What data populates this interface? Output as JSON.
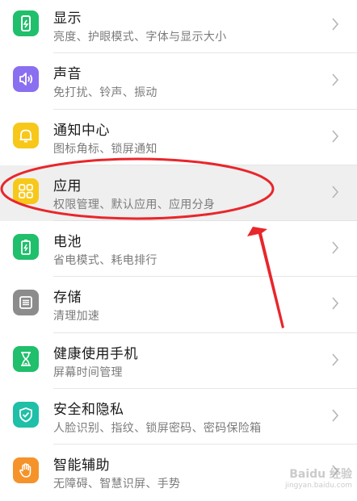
{
  "items": [
    {
      "title": "显示",
      "subtitle": "亮度、护眼模式、字体与显示大小",
      "icon": "display-icon",
      "color": "#1fbf6b",
      "highlight": false
    },
    {
      "title": "声音",
      "subtitle": "免打扰、铃声、振动",
      "icon": "sound-icon",
      "color": "#8a6ff0",
      "highlight": false
    },
    {
      "title": "通知中心",
      "subtitle": "图标角标、锁屏通知",
      "icon": "bell-icon",
      "color": "#f7c81a",
      "highlight": false
    },
    {
      "title": "应用",
      "subtitle": "权限管理、默认应用、应用分身",
      "icon": "apps-icon",
      "color": "#f7c81a",
      "highlight": true
    },
    {
      "title": "电池",
      "subtitle": "省电模式、耗电排行",
      "icon": "battery-icon",
      "color": "#1fbf6b",
      "highlight": false
    },
    {
      "title": "存储",
      "subtitle": "清理加速",
      "icon": "storage-icon",
      "color": "#8c8c8c",
      "highlight": false
    },
    {
      "title": "健康使用手机",
      "subtitle": "屏幕时间管理",
      "icon": "hourglass-icon",
      "color": "#1fbf6b",
      "highlight": false
    },
    {
      "title": "安全和隐私",
      "subtitle": "人脸识别、指纹、锁屏密码、密码保险箱",
      "icon": "shield-icon",
      "color": "#1fbfa8",
      "highlight": false
    },
    {
      "title": "智能辅助",
      "subtitle": "无障碍、智慧识屏、手势",
      "icon": "hand-icon",
      "color": "#f5932a",
      "highlight": false
    }
  ],
  "annotation": {
    "color": "#e8262b"
  },
  "watermark": {
    "line1": "Baidu 经验",
    "line2": "jingyan.baidu.com"
  }
}
